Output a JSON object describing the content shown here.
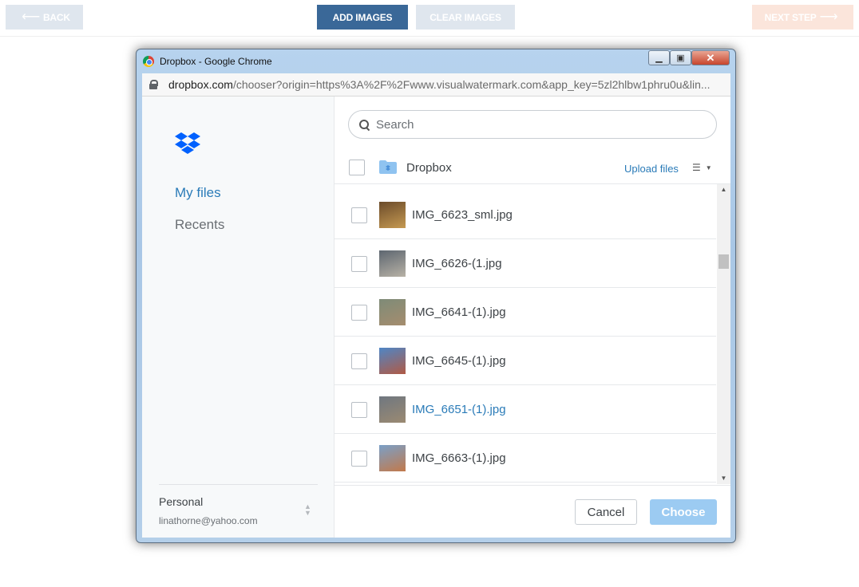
{
  "toolbar": {
    "back_label": "BACK",
    "add_images_label": "ADD IMAGES",
    "clear_images_label": "CLEAR IMAGES",
    "next_step_label": "NEXT STEP",
    "back_arrow": "⟵",
    "next_arrow": "⟶"
  },
  "window": {
    "title": "Dropbox - Google Chrome",
    "url_host": "dropbox.com",
    "url_path": "/chooser?origin=https%3A%2F%2Fwww.visualwatermark.com&app_key=5zl2hlbw1phru0u&lin..."
  },
  "sidebar": {
    "nav": [
      {
        "label": "My files",
        "active": true
      },
      {
        "label": "Recents",
        "active": false
      }
    ],
    "account": {
      "name": "Personal",
      "email": "linathorne@yahoo.com"
    }
  },
  "main": {
    "search_placeholder": "Search",
    "breadcrumb": "Dropbox",
    "upload_label": "Upload files",
    "files": [
      {
        "name": "IMG_6623_sml.jpg",
        "thumb_colors": [
          "#6b4b2a",
          "#c69a52"
        ]
      },
      {
        "name": "IMG_6626-(1.jpg",
        "thumb_colors": [
          "#5d6670",
          "#b8b2a6"
        ]
      },
      {
        "name": "IMG_6641-(1).jpg",
        "thumb_colors": [
          "#7e8b78",
          "#a58d6e"
        ]
      },
      {
        "name": "IMG_6645-(1).jpg",
        "thumb_colors": [
          "#4f86c6",
          "#b05a45"
        ]
      },
      {
        "name": "IMG_6651-(1).jpg",
        "thumb_colors": [
          "#6f7780",
          "#9b8a72"
        ]
      },
      {
        "name": "IMG_6663-(1).jpg",
        "thumb_colors": [
          "#7aa0c8",
          "#c2794b"
        ]
      }
    ],
    "hover_index": 4,
    "cancel_label": "Cancel",
    "choose_label": "Choose"
  },
  "colors": {
    "accent": "#2a7bb8",
    "add_button": "#3a6898",
    "choose_disabled": "#9ccbf2",
    "next_disabled": "#fbe5db"
  }
}
